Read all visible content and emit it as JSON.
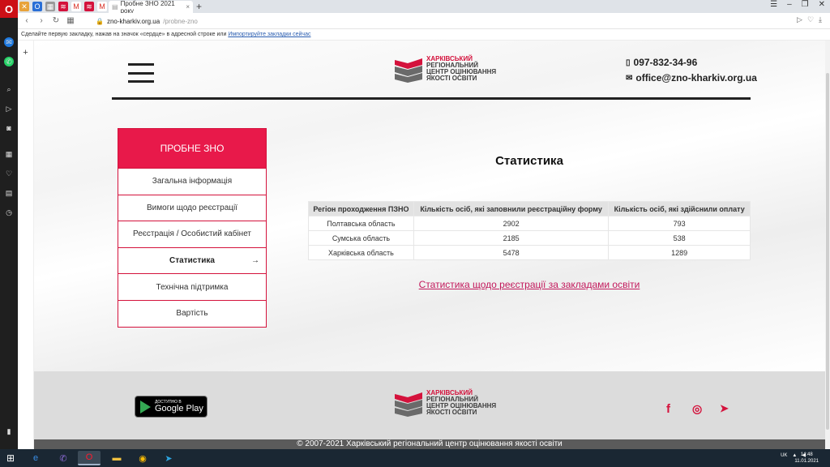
{
  "browser": {
    "opera_logo": "O",
    "active_tab_title": "Пробне ЗНО 2021 року",
    "url_domain": "zno-kharkiv.org.ua",
    "url_path": "/probne-zno",
    "bookmark_hint": "Сделайте первую закладку, нажав на значок «сердце» в адресной строке или ",
    "bookmark_link": "Импортируйте закладки сейчас"
  },
  "header": {
    "logo_line1": "Харківський",
    "logo_line2": "регіональний",
    "logo_line3": "центр оцінювання",
    "logo_line4": "якості освіти",
    "phone": "097-832-34-96",
    "email": "office@zno-kharkiv.org.ua"
  },
  "menu": {
    "title": "ПРОБНЕ ЗНО",
    "items": [
      {
        "label": "Загальна інформація"
      },
      {
        "label": "Вимоги щодо реєстрації"
      },
      {
        "label": "Реєстрація / Особистий кабінет"
      },
      {
        "label": "Статистика"
      },
      {
        "label": "Технічна підтримка"
      },
      {
        "label": "Вартість"
      }
    ]
  },
  "main": {
    "title": "Статистика",
    "table": {
      "headers": [
        "Регіон проходження ПЗНО",
        "Кількість осіб, які заповнили реєстраційну форму",
        "Кількість осіб, які здійснили оплату"
      ],
      "rows": [
        [
          "Полтавська область",
          "2902",
          "793"
        ],
        [
          "Сумська область",
          "2185",
          "538"
        ],
        [
          "Харківська область",
          "5478",
          "1289"
        ]
      ]
    },
    "link": "Статистика щодо реєстрації за закладами освіти"
  },
  "footer": {
    "gplay_small": "ДОСТУПНО В",
    "gplay_big": "Google Play",
    "copyright": "© 2007-2021 Харківський регіональний центр оцінювання якості освіти"
  },
  "taskbar": {
    "lang": "UK",
    "time": "14:48",
    "date": "11.01.2021"
  },
  "colors": {
    "brand_red": "#e8194a",
    "link": "#c2185b",
    "footer_bg": "#dcdcdc"
  }
}
